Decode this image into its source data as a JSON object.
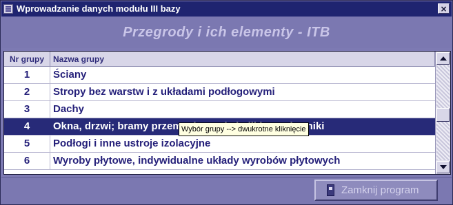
{
  "window": {
    "title": "Wprowadzanie danych modułu III bazy",
    "close_icon": "×"
  },
  "header": {
    "title": "Przegrody i ich elementy - ITB"
  },
  "table": {
    "columns": [
      "Nr grupy",
      "Nazwa grupy"
    ],
    "rows": [
      {
        "nr": "1",
        "name": "Ściany"
      },
      {
        "nr": "2",
        "name": "Stropy bez warstw i z układami podłogowymi"
      },
      {
        "nr": "3",
        "name": "Dachy"
      },
      {
        "nr": "4",
        "name": "Okna, drzwi; bramy przemysłowe, świetliki, wywiewniki"
      },
      {
        "nr": "5",
        "name": "Podłogi i inne ustroje izolacyjne"
      },
      {
        "nr": "6",
        "name": "Wyroby płytowe, indywidualne układy wyrobów płytowych"
      }
    ],
    "selected_index": 3
  },
  "tooltip": {
    "text": "Wybór grupy --> dwukrotne kliknięcie"
  },
  "footer": {
    "close_program_label": "Zamknij program"
  },
  "colors": {
    "window_bg": "#7b78b1",
    "titlebar": "#1f2470",
    "selection": "#272a78",
    "text": "#25207a",
    "header_title": "#c9c5e8"
  },
  "icons": {
    "app": "app-window-icon",
    "close": "close-icon",
    "button": "exit-door-icon"
  }
}
